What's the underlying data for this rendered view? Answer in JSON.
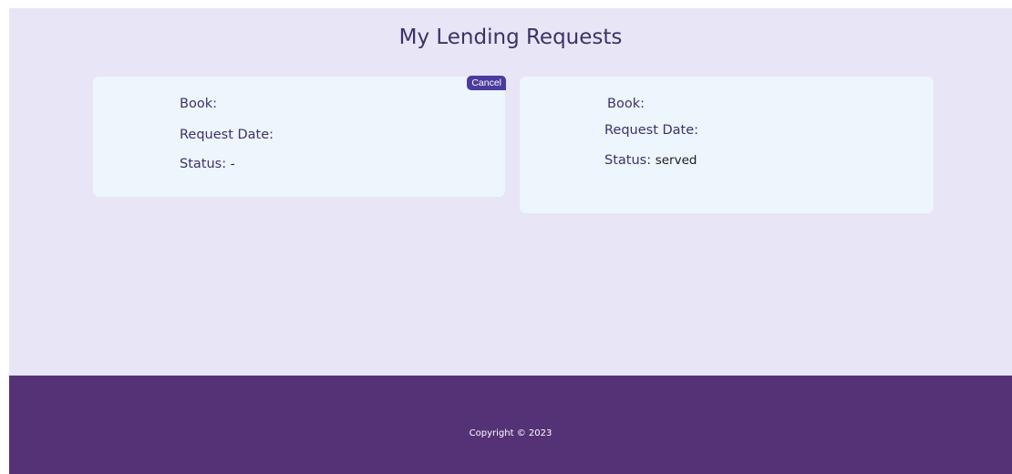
{
  "page": {
    "title": "My Lending Requests"
  },
  "requests": [
    {
      "book_label": "Book:",
      "book_value": "",
      "date_label": "Request Date:",
      "date_value": "",
      "status_label": "Status:",
      "status_value": "-",
      "cancel_label": "Cancel"
    },
    {
      "book_label": "Book:",
      "book_value": "",
      "date_label": "Request Date:",
      "date_value": "",
      "status_label": "Status:",
      "status_value": "served"
    }
  ],
  "footer": {
    "copyright": "Copyright © 2023"
  },
  "colors": {
    "page_background": "#e8e5f7",
    "card_background": "#edf5fd",
    "accent": "#4b3b9e",
    "footer_background": "#553276",
    "text_primary": "#3d3166"
  }
}
